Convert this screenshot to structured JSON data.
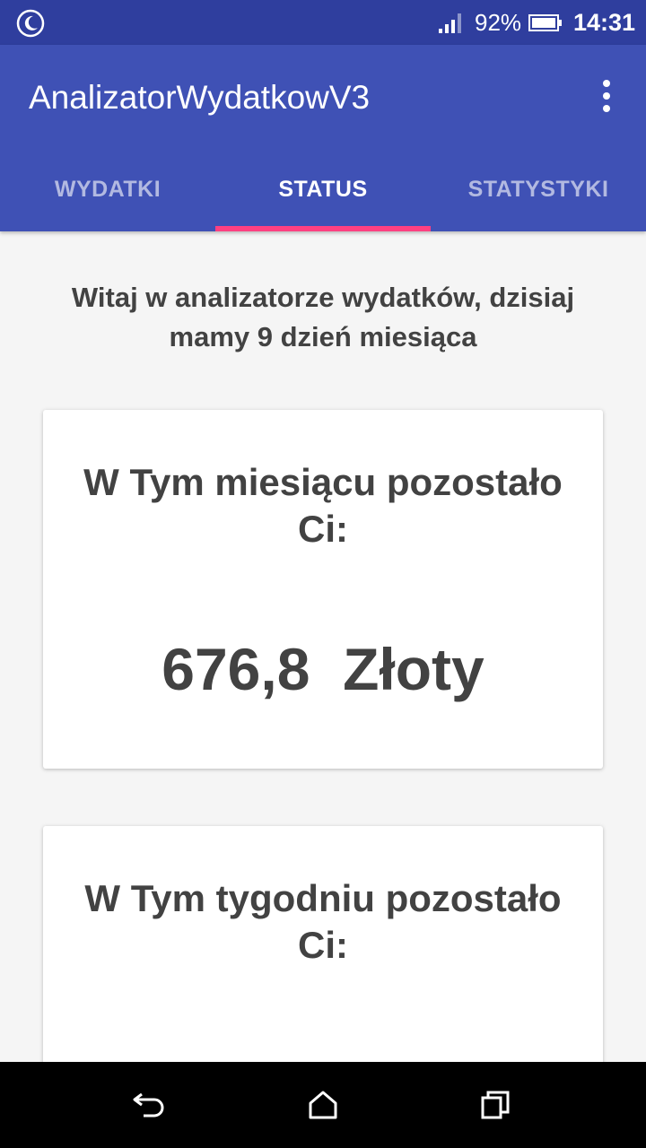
{
  "status_bar": {
    "battery_percent": "92%",
    "time": "14:31",
    "icons": [
      "night-mode-icon",
      "signal-icon",
      "battery-icon"
    ]
  },
  "app_bar": {
    "title": "AnalizatorWydatkowV3",
    "overflow_icon": "more-vert-icon"
  },
  "tabs": [
    {
      "label": "WYDATKI",
      "active": false
    },
    {
      "label": "STATUS",
      "active": true
    },
    {
      "label": "STATYSTYKI",
      "active": false
    }
  ],
  "content": {
    "welcome": "Witaj w analizatorze wydatków, dzisiaj mamy 9 dzień miesiąca",
    "month_card": {
      "label": "W Tym miesiącu pozostało Ci:",
      "value": "676,8  Złoty"
    },
    "week_card": {
      "label": "W Tym tygodniu pozostało Ci:"
    }
  },
  "nav_bar": {
    "buttons": [
      "back-icon",
      "home-icon",
      "recents-icon"
    ]
  },
  "colors": {
    "primary": "#3f51b5",
    "primary_dark": "#2f3e9e",
    "accent": "#ff4081",
    "text": "#424242",
    "background": "#f5f5f5"
  }
}
